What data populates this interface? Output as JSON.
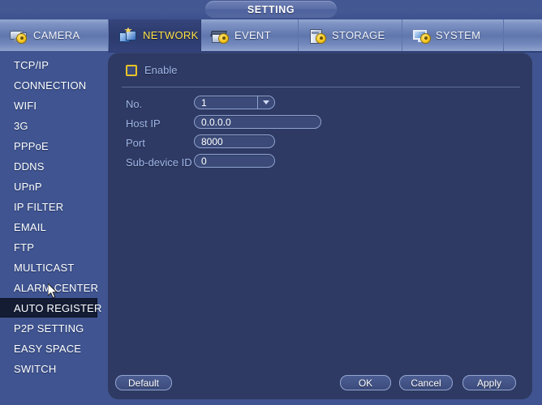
{
  "window": {
    "title": "SETTING"
  },
  "tabs": [
    {
      "label": "CAMERA",
      "icon": "camera-icon",
      "active": false
    },
    {
      "label": "NETWORK",
      "icon": "network-icon",
      "active": true
    },
    {
      "label": "EVENT",
      "icon": "event-icon",
      "active": false
    },
    {
      "label": "STORAGE",
      "icon": "storage-icon",
      "active": false
    },
    {
      "label": "SYSTEM",
      "icon": "system-icon",
      "active": false
    }
  ],
  "sidebar": {
    "selected": "AUTO REGISTER",
    "items": [
      {
        "label": "TCP/IP"
      },
      {
        "label": "CONNECTION"
      },
      {
        "label": "WIFI"
      },
      {
        "label": "3G"
      },
      {
        "label": "PPPoE"
      },
      {
        "label": "DDNS"
      },
      {
        "label": "UPnP"
      },
      {
        "label": "IP FILTER"
      },
      {
        "label": "EMAIL"
      },
      {
        "label": "FTP"
      },
      {
        "label": "MULTICAST"
      },
      {
        "label": "ALARM CENTER"
      },
      {
        "label": "AUTO REGISTER"
      },
      {
        "label": "P2P SETTING"
      },
      {
        "label": "EASY SPACE"
      },
      {
        "label": "SWITCH"
      }
    ]
  },
  "form": {
    "enable": {
      "label": "Enable",
      "checked": false
    },
    "fields": [
      {
        "label": "No.",
        "value": "1",
        "type": "select"
      },
      {
        "label": "Host IP",
        "value": "0.0.0.0",
        "type": "text"
      },
      {
        "label": "Port",
        "value": "8000",
        "type": "text"
      },
      {
        "label": "Sub-device ID",
        "value": "0",
        "type": "text"
      }
    ]
  },
  "footer": {
    "default_label": "Default",
    "ok_label": "OK",
    "cancel_label": "Cancel",
    "apply_label": "Apply"
  },
  "colors": {
    "page_background": "#3f5490",
    "panel_background": "#2e3a63",
    "accent_yellow": "#ffe24a",
    "checkbox_border": "#e8c427",
    "label_text": "#9fb6e8",
    "selected_item_background": "#141c33"
  }
}
